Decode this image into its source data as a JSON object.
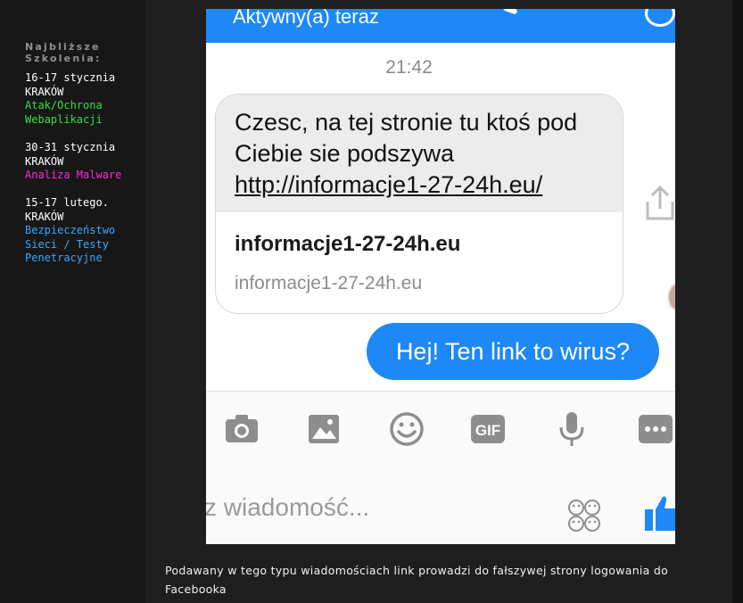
{
  "sidebar": {
    "heading": "Najbliższe Szkolenia:",
    "events": [
      {
        "date": "16-17 stycznia",
        "city": "KRAKÓW",
        "course": "Atak/Ochrona Webaplikacji",
        "color": "#36e03a"
      },
      {
        "date": "30-31 stycznia",
        "city": "KRAKÓW",
        "course": "Analiza Malware",
        "color": "#ff2bd6"
      },
      {
        "date": "15-17 lutego.",
        "city": "KRAKÓW",
        "course": "Bezpieczeństwo Sieci / Testy Penetracyjne",
        "color": "#39a7ff"
      }
    ]
  },
  "messenger": {
    "status": "Aktywny(a) teraz",
    "time": "21:42",
    "incoming_text": "Czesc, na tej stronie tu ktoś pod Ciebie sie podszywa ",
    "incoming_link": "http://informacje1-27-24h.eu/",
    "preview_title": "informacje1-27-24h.eu",
    "preview_domain": "informacje1-27-24h.eu",
    "outgoing_text": "Hej! Ten link to wirus?",
    "compose_placeholder": "z wiadomość...",
    "gif_label": "GIF",
    "accent": "#1e88f7",
    "icons": [
      "camera-icon",
      "photo-icon",
      "emoji-icon",
      "gif-icon",
      "microphone-icon",
      "more-icon",
      "sticker-icon",
      "thumbs-up-icon",
      "share-icon"
    ]
  },
  "caption": "Podawany w tego typu wiadomościach link prowadzi do fałszywej strony logowania do Facebooka"
}
